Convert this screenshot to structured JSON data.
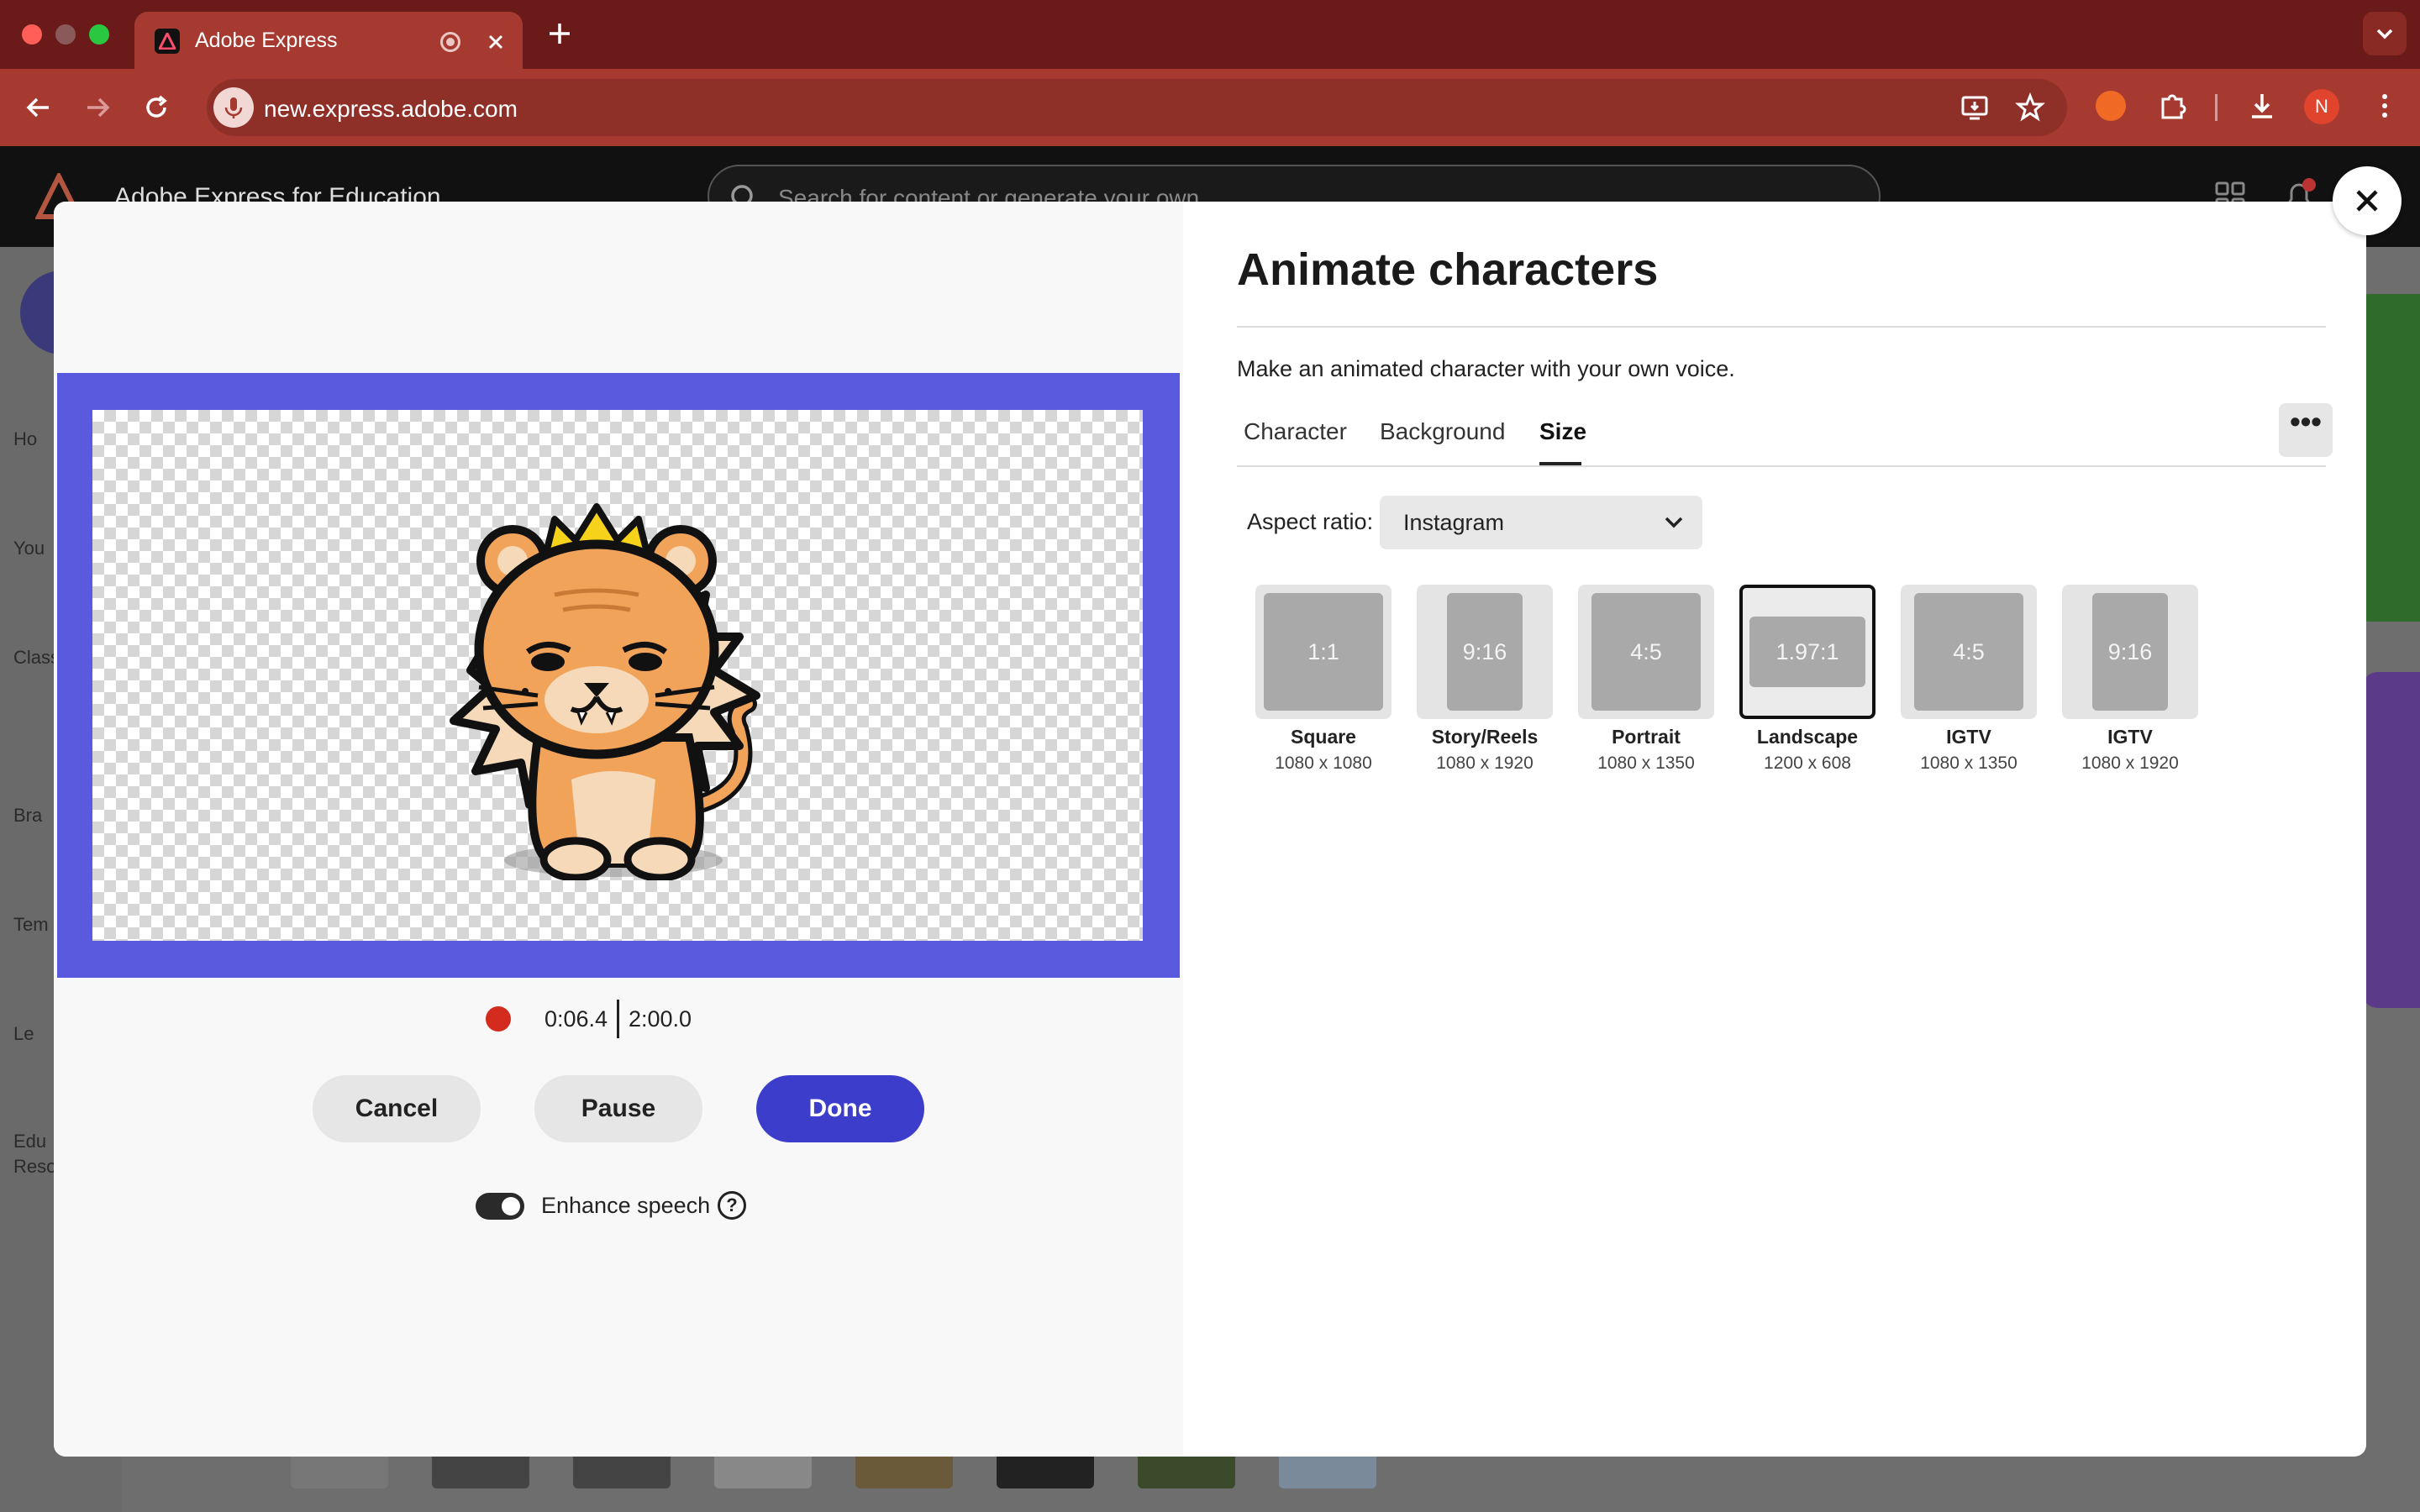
{
  "browser": {
    "tab_title": "Adobe Express",
    "url": "new.express.adobe.com",
    "profile_initial": "N"
  },
  "app": {
    "title": "Adobe Express for Education",
    "search_placeholder": "Search for content or generate your own",
    "sidebar_labels": [
      "Ho",
      "You",
      "Class",
      "Bra",
      "Tem",
      "Le",
      "Edu",
      "Reso"
    ]
  },
  "modal": {
    "title": "Animate characters",
    "description": "Make an animated character with your own voice.",
    "tabs": [
      {
        "label": "Character",
        "active": false
      },
      {
        "label": "Background",
        "active": false
      },
      {
        "label": "Size",
        "active": true
      }
    ],
    "more_label": "•••",
    "aspect_label": "Aspect ratio:",
    "aspect_value": "Instagram",
    "sizes": [
      {
        "ratio": "1:1",
        "name": "Square",
        "dims": "1080 x 1080",
        "selected": false
      },
      {
        "ratio": "9:16",
        "name": "Story/Reels",
        "dims": "1080 x 1920",
        "selected": false
      },
      {
        "ratio": "4:5",
        "name": "Portrait",
        "dims": "1080 x 1350",
        "selected": false
      },
      {
        "ratio": "1.97:1",
        "name": "Landscape",
        "dims": "1200 x 608",
        "selected": true
      },
      {
        "ratio": "4:5",
        "name": "IGTV",
        "dims": "1080 x 1350",
        "selected": false
      },
      {
        "ratio": "9:16",
        "name": "IGTV",
        "dims": "1080 x 1920",
        "selected": false
      }
    ],
    "recording": {
      "current_time": "0:06.4",
      "total_time": "2:00.0"
    },
    "buttons": {
      "cancel": "Cancel",
      "pause": "Pause",
      "done": "Done"
    },
    "enhance_speech": {
      "label": "Enhance speech",
      "enabled": true,
      "help": "?"
    }
  },
  "colors": {
    "stage_border": "#5a5adf",
    "primary_button": "#3d3dcc",
    "record": "#d32b1e",
    "browser_chrome": "#a63a31"
  }
}
